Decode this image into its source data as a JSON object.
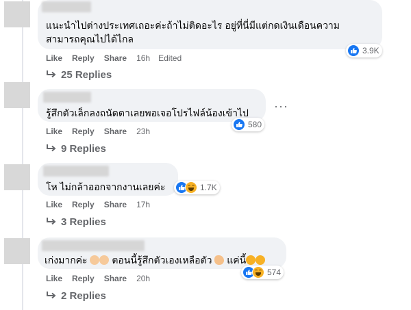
{
  "comments": [
    {
      "text_lines": [
        "แนะนำไปต่างประเทศเถอะค่ะถ้าไม่ติดอะไร อยู่ที่นี่มีแต่กดเงินเดือนความ",
        "สามารถคุณไปได้ไกล"
      ],
      "reaction_count": "3.9K",
      "actions": {
        "like": "Like",
        "reply": "Reply",
        "share": "Share",
        "time": "16h",
        "edited": "Edited"
      },
      "replies_label": "25 Replies"
    },
    {
      "text_lines": [
        "รู้สึกตัวเล็กลงถนัดตาเลยพอเจอโปรไฟล์น้องเข้าไป"
      ],
      "reaction_count": "580",
      "actions": {
        "like": "Like",
        "reply": "Reply",
        "share": "Share",
        "time": "23h"
      },
      "replies_label": "9 Replies"
    },
    {
      "text_lines": [
        "โห ไม่กล้าออกจากงานเลยค่ะ"
      ],
      "reaction_count": "1.7K",
      "actions": {
        "like": "Like",
        "reply": "Reply",
        "share": "Share",
        "time": "17h"
      },
      "replies_label": "3 Replies"
    },
    {
      "text_parts": [
        "เก่งมากค่ะ",
        "ตอนนี้รู้สึกตัวเองเหลือตัว",
        "แค่นี้"
      ],
      "reaction_count": "574",
      "actions": {
        "like": "Like",
        "reply": "Reply",
        "share": "Share",
        "time": "20h"
      },
      "replies_label": "2 Replies"
    }
  ],
  "icons": {
    "like": "thumbs-up-icon",
    "haha": "laughing-face-icon",
    "reply_arrow": "reply-arrow-icon",
    "more": "more-options-icon"
  },
  "colors": {
    "bubble": "#f0f2f5",
    "meta_text": "#65676b",
    "like_blue": "#1877f2",
    "haha_yellow": "#f7b125"
  }
}
